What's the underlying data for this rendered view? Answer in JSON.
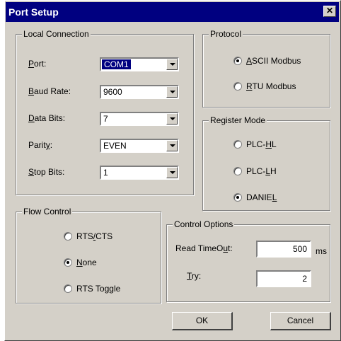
{
  "window": {
    "title": "Port Setup",
    "close_glyph": "✕"
  },
  "local_connection": {
    "title": "Local Connection",
    "port": {
      "label": "Port:",
      "value": "COM1"
    },
    "baud_rate": {
      "label": "Baud Rate:",
      "value": "9600"
    },
    "data_bits": {
      "label": "Data Bits:",
      "value": "7"
    },
    "parity": {
      "label": "Parity:",
      "value": "EVEN"
    },
    "stop_bits": {
      "label": "Stop Bits:",
      "value": "1"
    }
  },
  "protocol": {
    "title": "Protocol",
    "options": [
      {
        "label": "ASCII Modbus",
        "selected": true
      },
      {
        "label": "RTU Modbus",
        "selected": false
      }
    ]
  },
  "register_mode": {
    "title": "Register Mode",
    "options": [
      {
        "label": "PLC-HL",
        "selected": false
      },
      {
        "label": "PLC-LH",
        "selected": false
      },
      {
        "label": "DANIEL",
        "selected": true
      }
    ]
  },
  "flow_control": {
    "title": "Flow Control",
    "options": [
      {
        "label": "RTS/CTS",
        "selected": false
      },
      {
        "label": "None",
        "selected": true
      },
      {
        "label": "RTS Toggle",
        "selected": false
      }
    ]
  },
  "control_options": {
    "title": "Control Options",
    "read_timeout": {
      "label": "Read TimeOut:",
      "value": "500",
      "unit": "ms"
    },
    "try": {
      "label": "Try:",
      "value": "2"
    }
  },
  "buttons": {
    "ok": "OK",
    "cancel": "Cancel"
  }
}
